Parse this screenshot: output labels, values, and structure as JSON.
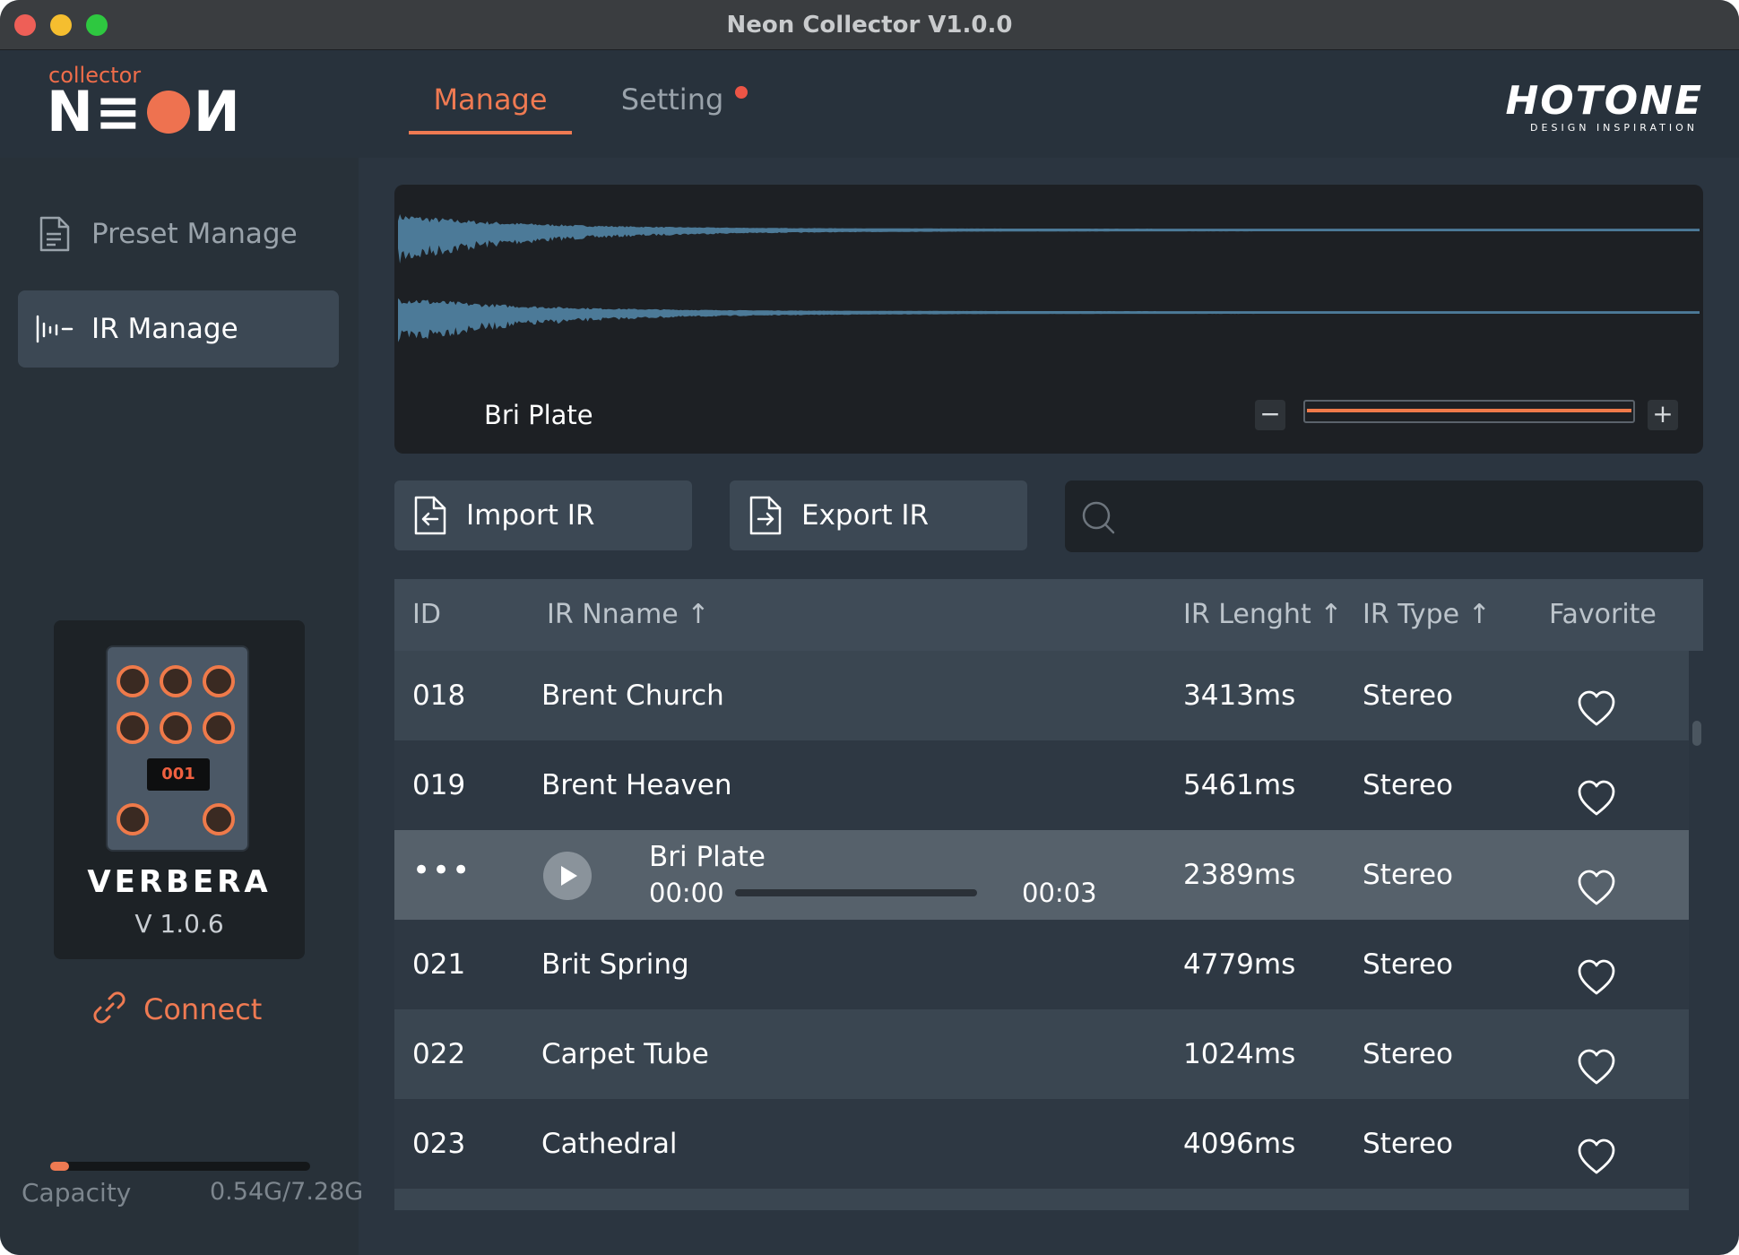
{
  "window": {
    "title": "Neon Collector V1.0.0"
  },
  "header": {
    "logo_small": "collector",
    "logo_left": "N≡",
    "logo_right": "И",
    "tabs": [
      {
        "label": "Manage",
        "active": true
      },
      {
        "label": "Setting",
        "active": false,
        "notification_dot": true
      }
    ],
    "brand": {
      "name": "HOTONE",
      "tagline": "DESIGN INSPIRATION"
    }
  },
  "sidebar": {
    "items": [
      {
        "label": "Preset Manage",
        "icon": "document-icon",
        "active": false
      },
      {
        "label": "IR Manage",
        "icon": "waveform-icon",
        "active": true
      }
    ],
    "device": {
      "name": "VERBERA",
      "version": "V 1.0.6",
      "screen_text": "001"
    },
    "connect_label": "Connect",
    "capacity": {
      "label": "Capacity",
      "value": "0.54G/7.28G",
      "used_fraction": 0.074
    }
  },
  "waveform": {
    "title": "Bri Plate",
    "zoom_level_fraction": 1.0,
    "wave_color": "#4c7a98"
  },
  "actions": {
    "import_label": "Import IR",
    "export_label": "Export IR",
    "search_placeholder": ""
  },
  "table": {
    "columns": {
      "id": "ID",
      "name": "IR Nname ↑",
      "length": "IR Lenght ↑",
      "type": "IR Type ↑",
      "favorite": "Favorite"
    },
    "rows": [
      {
        "id": "018",
        "name": "Brent Church",
        "length": "3413ms",
        "type": "Stereo",
        "favorite": false
      },
      {
        "id": "019",
        "name": "Brent Heaven",
        "length": "5461ms",
        "type": "Stereo",
        "favorite": false
      },
      {
        "id": "•••",
        "name": "Bri Plate",
        "length": "2389ms",
        "type": "Stereo",
        "favorite": false,
        "playing": true,
        "player": {
          "current": "00:00",
          "duration": "00:03",
          "progress_fraction": 0.0
        }
      },
      {
        "id": "021",
        "name": "Brit Spring",
        "length": "4779ms",
        "type": "Stereo",
        "favorite": false
      },
      {
        "id": "022",
        "name": "Carpet Tube",
        "length": "1024ms",
        "type": "Stereo",
        "favorite": false
      },
      {
        "id": "023",
        "name": "Cathedral",
        "length": "4096ms",
        "type": "Stereo",
        "favorite": false
      }
    ]
  },
  "colors": {
    "accent": "#ef7a52",
    "background": "#2b3540",
    "sidebar": "#283139",
    "row_odd": "#3a4651",
    "row_even": "#2e3843",
    "row_active": "#56616b"
  }
}
